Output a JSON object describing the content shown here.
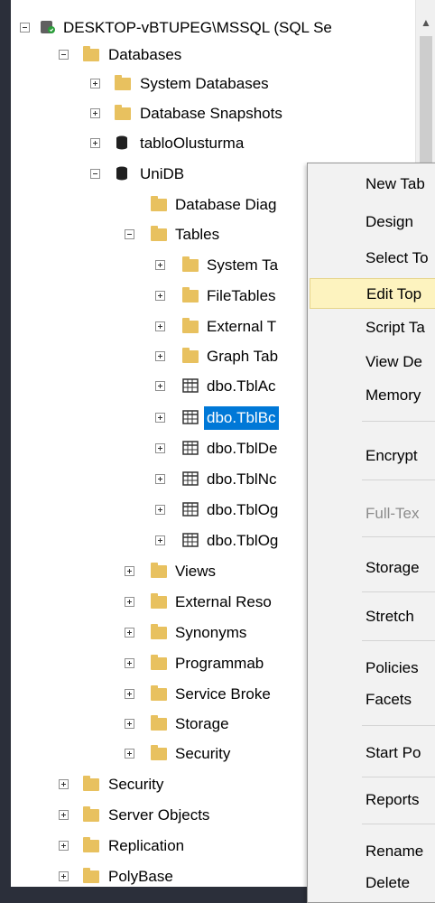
{
  "tree": {
    "server": {
      "label": "DESKTOP-vBTUPEG\\MSSQL (SQL Se"
    },
    "databases": {
      "label": "Databases"
    },
    "system_databases": {
      "label": "System Databases"
    },
    "database_snapshots": {
      "label": "Database Snapshots"
    },
    "tablo_olusturma": {
      "label": "tabloOlusturma"
    },
    "unidb": {
      "label": "UniDB"
    },
    "database_diagrams": {
      "label": "Database Diag"
    },
    "tables": {
      "label": "Tables"
    },
    "system_tables": {
      "label": "System Ta"
    },
    "file_tables": {
      "label": "FileTables"
    },
    "external_tables": {
      "label": "External T"
    },
    "graph_tables": {
      "label": "Graph Tab"
    },
    "tbl_1": {
      "label": "dbo.TblAc"
    },
    "tbl_2": {
      "label": "dbo.TblBc"
    },
    "tbl_3": {
      "label": "dbo.TblDe"
    },
    "tbl_4": {
      "label": "dbo.TblNc"
    },
    "tbl_5": {
      "label": "dbo.TblOg"
    },
    "tbl_6": {
      "label": "dbo.TblOg"
    },
    "views": {
      "label": "Views"
    },
    "external_resources": {
      "label": "External Reso"
    },
    "synonyms": {
      "label": "Synonyms"
    },
    "programmability": {
      "label": "Programmab"
    },
    "service_broker": {
      "label": "Service Broke"
    },
    "storage": {
      "label": "Storage"
    },
    "security_db": {
      "label": "Security"
    },
    "security": {
      "label": "Security"
    },
    "server_objects": {
      "label": "Server Objects"
    },
    "replication": {
      "label": "Replication"
    },
    "polybase": {
      "label": "PolyBase"
    }
  },
  "context_menu": {
    "items": [
      {
        "label": "New Tab"
      },
      {
        "label": "Design"
      },
      {
        "label": "Select To"
      },
      {
        "label": "Edit Top"
      },
      {
        "label": "Script Ta"
      },
      {
        "label": "View De"
      },
      {
        "label": "Memory"
      },
      {
        "label": "Encrypt"
      },
      {
        "label": "Full-Tex"
      },
      {
        "label": "Storage"
      },
      {
        "label": "Stretch"
      },
      {
        "label": "Policies"
      },
      {
        "label": "Facets"
      },
      {
        "label": "Start Po"
      },
      {
        "label": "Reports"
      },
      {
        "label": "Rename"
      },
      {
        "label": "Delete"
      }
    ]
  },
  "colors": {
    "selection": "#0078d7",
    "menu_highlight": "#fdf3bf",
    "folder": "#e8c15f"
  }
}
